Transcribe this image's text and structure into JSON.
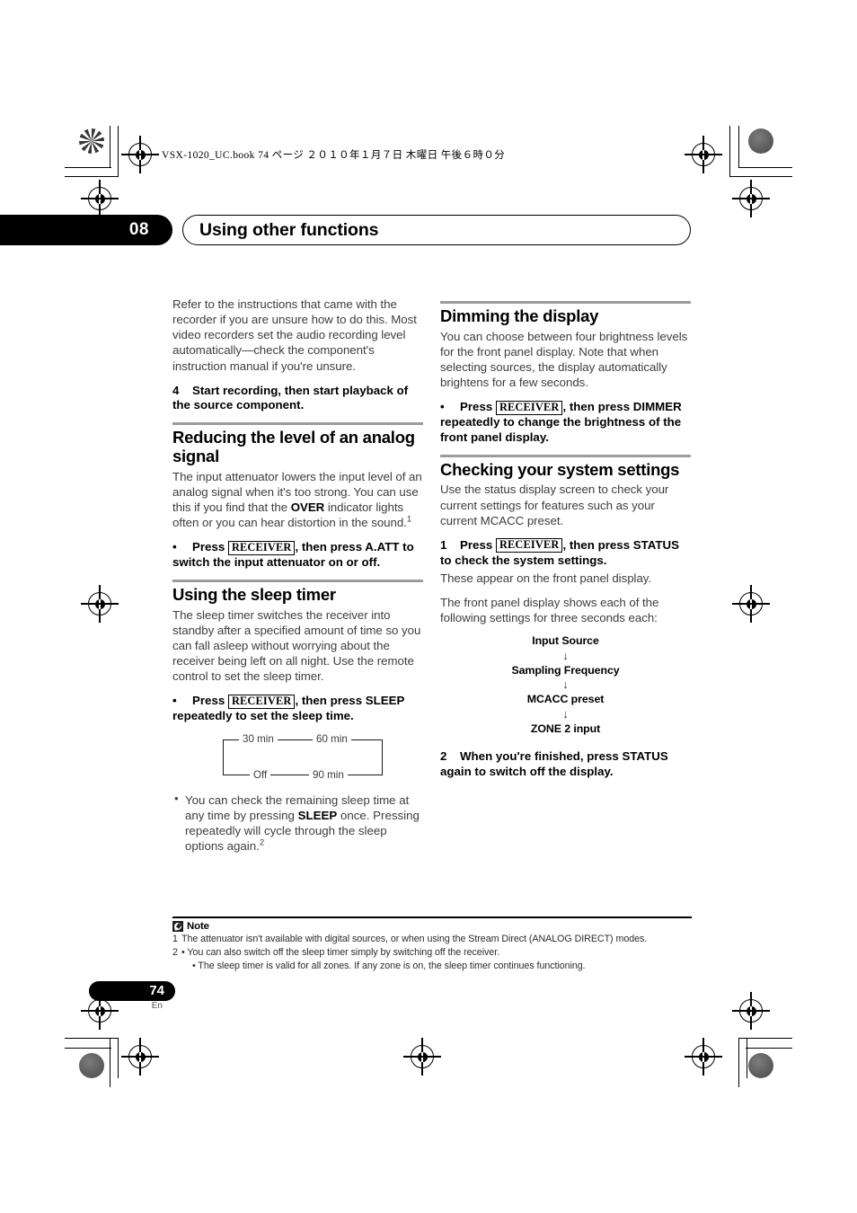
{
  "header": {
    "book_line": "VSX-1020_UC.book   74 ページ   ２０１０年１月７日   木曜日   午後６時０分",
    "chapter_number": "08",
    "chapter_title": "Using other functions"
  },
  "left_column": {
    "intro_paragraph": "Refer to the instructions that came with the recorder if you are unsure how to do this. Most video recorders set the audio recording level automatically—check the component's instruction manual if you're unsure.",
    "step4": {
      "number": "4",
      "text": "Start recording, then start playback of the source component."
    },
    "section_attenuator": {
      "heading": "Reducing the level of an analog signal",
      "paragraph_a": "The input attenuator lowers the input level of an analog signal when it's too strong. You can use this if you find that the ",
      "keyword_over": "OVER",
      "paragraph_b": " indicator lights often or you can hear distortion in the sound.",
      "footnote_marker": "1",
      "bullet": {
        "dot": "•",
        "press_label": "Press",
        "keycap": "RECEIVER",
        "rest": ", then press A.ATT to switch the input attenuator on or off."
      }
    },
    "section_sleep": {
      "heading": "Using the sleep timer",
      "paragraph": "The sleep timer switches the receiver into standby after a specified amount of time so you can fall asleep without worrying about the receiver being left on all night. Use the remote control to set the sleep timer.",
      "bullet": {
        "dot": "•",
        "press_label": "Press",
        "keycap": "RECEIVER",
        "rest": ", then press SLEEP repeatedly to set the sleep time."
      },
      "loop_diagram": {
        "top_left": "30 min",
        "top_right": "60 min",
        "bottom_left": "Off",
        "bottom_right": "90 min"
      },
      "note_bullet_a": "You can check the remaining sleep time at any time by pressing ",
      "note_bullet_keyword": "SLEEP",
      "note_bullet_b": " once. Pressing repeatedly will cycle through the sleep options again.",
      "note_bullet_footnote": "2"
    }
  },
  "right_column": {
    "section_dimmer": {
      "heading": "Dimming the display",
      "paragraph": "You can choose between four brightness levels for the front panel display. Note that when selecting sources, the display automatically brightens for a few seconds.",
      "bullet": {
        "dot": "•",
        "press_label": "Press",
        "keycap": "RECEIVER",
        "rest": ", then press DIMMER repeatedly to change the brightness of the front panel display."
      }
    },
    "section_status": {
      "heading": "Checking your system settings",
      "paragraph": "Use the status display screen to check your current settings for features such as your current MCACC preset.",
      "step1": {
        "number": "1",
        "press_label": "Press",
        "keycap": "RECEIVER",
        "rest": ", then press STATUS to check the system settings."
      },
      "step1_note": "These appear on the front panel display.",
      "flow_intro": "The front panel display shows each of the following settings for three seconds each:",
      "flow_nodes": [
        "Input Source",
        "Sampling Frequency",
        "MCACC preset",
        "ZONE 2 input"
      ],
      "flow_arrow": "↓",
      "step2": {
        "number": "2",
        "text": "When you're finished, press STATUS again to switch off the display."
      }
    }
  },
  "notes": {
    "label": "Note",
    "items": [
      {
        "index": "1",
        "text": "The attenuator isn't available with digital sources, or when using the Stream Direct (ANALOG DIRECT) modes."
      },
      {
        "index": "2",
        "text": "• You can also switch off the sleep timer simply by switching off the receiver."
      },
      {
        "index": "",
        "text": "• The sleep timer is valid for all zones. If any zone is on, the sleep timer continues functioning."
      }
    ]
  },
  "footer": {
    "page_number": "74",
    "language": "En"
  },
  "colors": {
    "rule_gray": "#9b9b9b",
    "body_text": "#3d3d3d",
    "accent_black": "#000000"
  }
}
